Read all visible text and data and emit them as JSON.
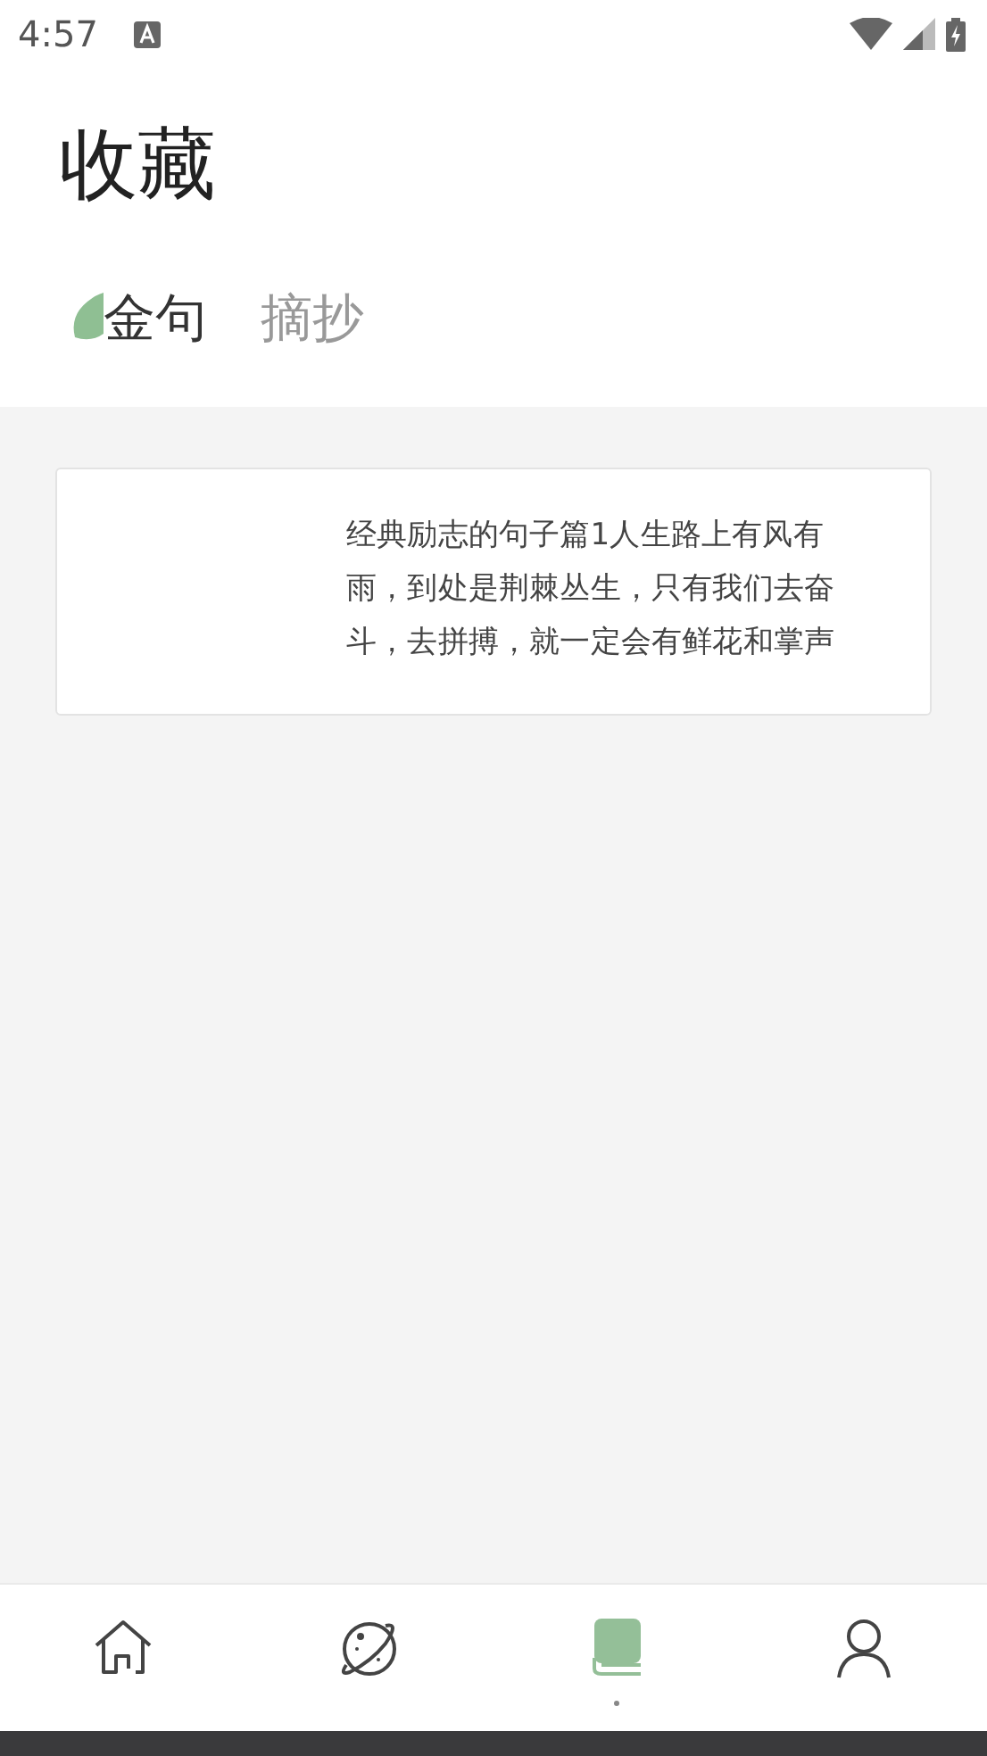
{
  "status_bar": {
    "time": "4:57"
  },
  "title": "收藏",
  "tabs": [
    {
      "label": "金句",
      "selected": true
    },
    {
      "label": "摘抄",
      "selected": false
    }
  ],
  "cards": [
    {
      "text": "经典励志的句子篇1人生路上有风有雨，到处是荆棘丛生，只有我们去奋斗，去拼搏，就一定会有鲜花和掌声"
    }
  ],
  "bottom_nav": [
    {
      "kind": "home",
      "selected": false
    },
    {
      "kind": "planet",
      "selected": false
    },
    {
      "kind": "book",
      "selected": true
    },
    {
      "kind": "profile",
      "selected": false
    }
  ]
}
